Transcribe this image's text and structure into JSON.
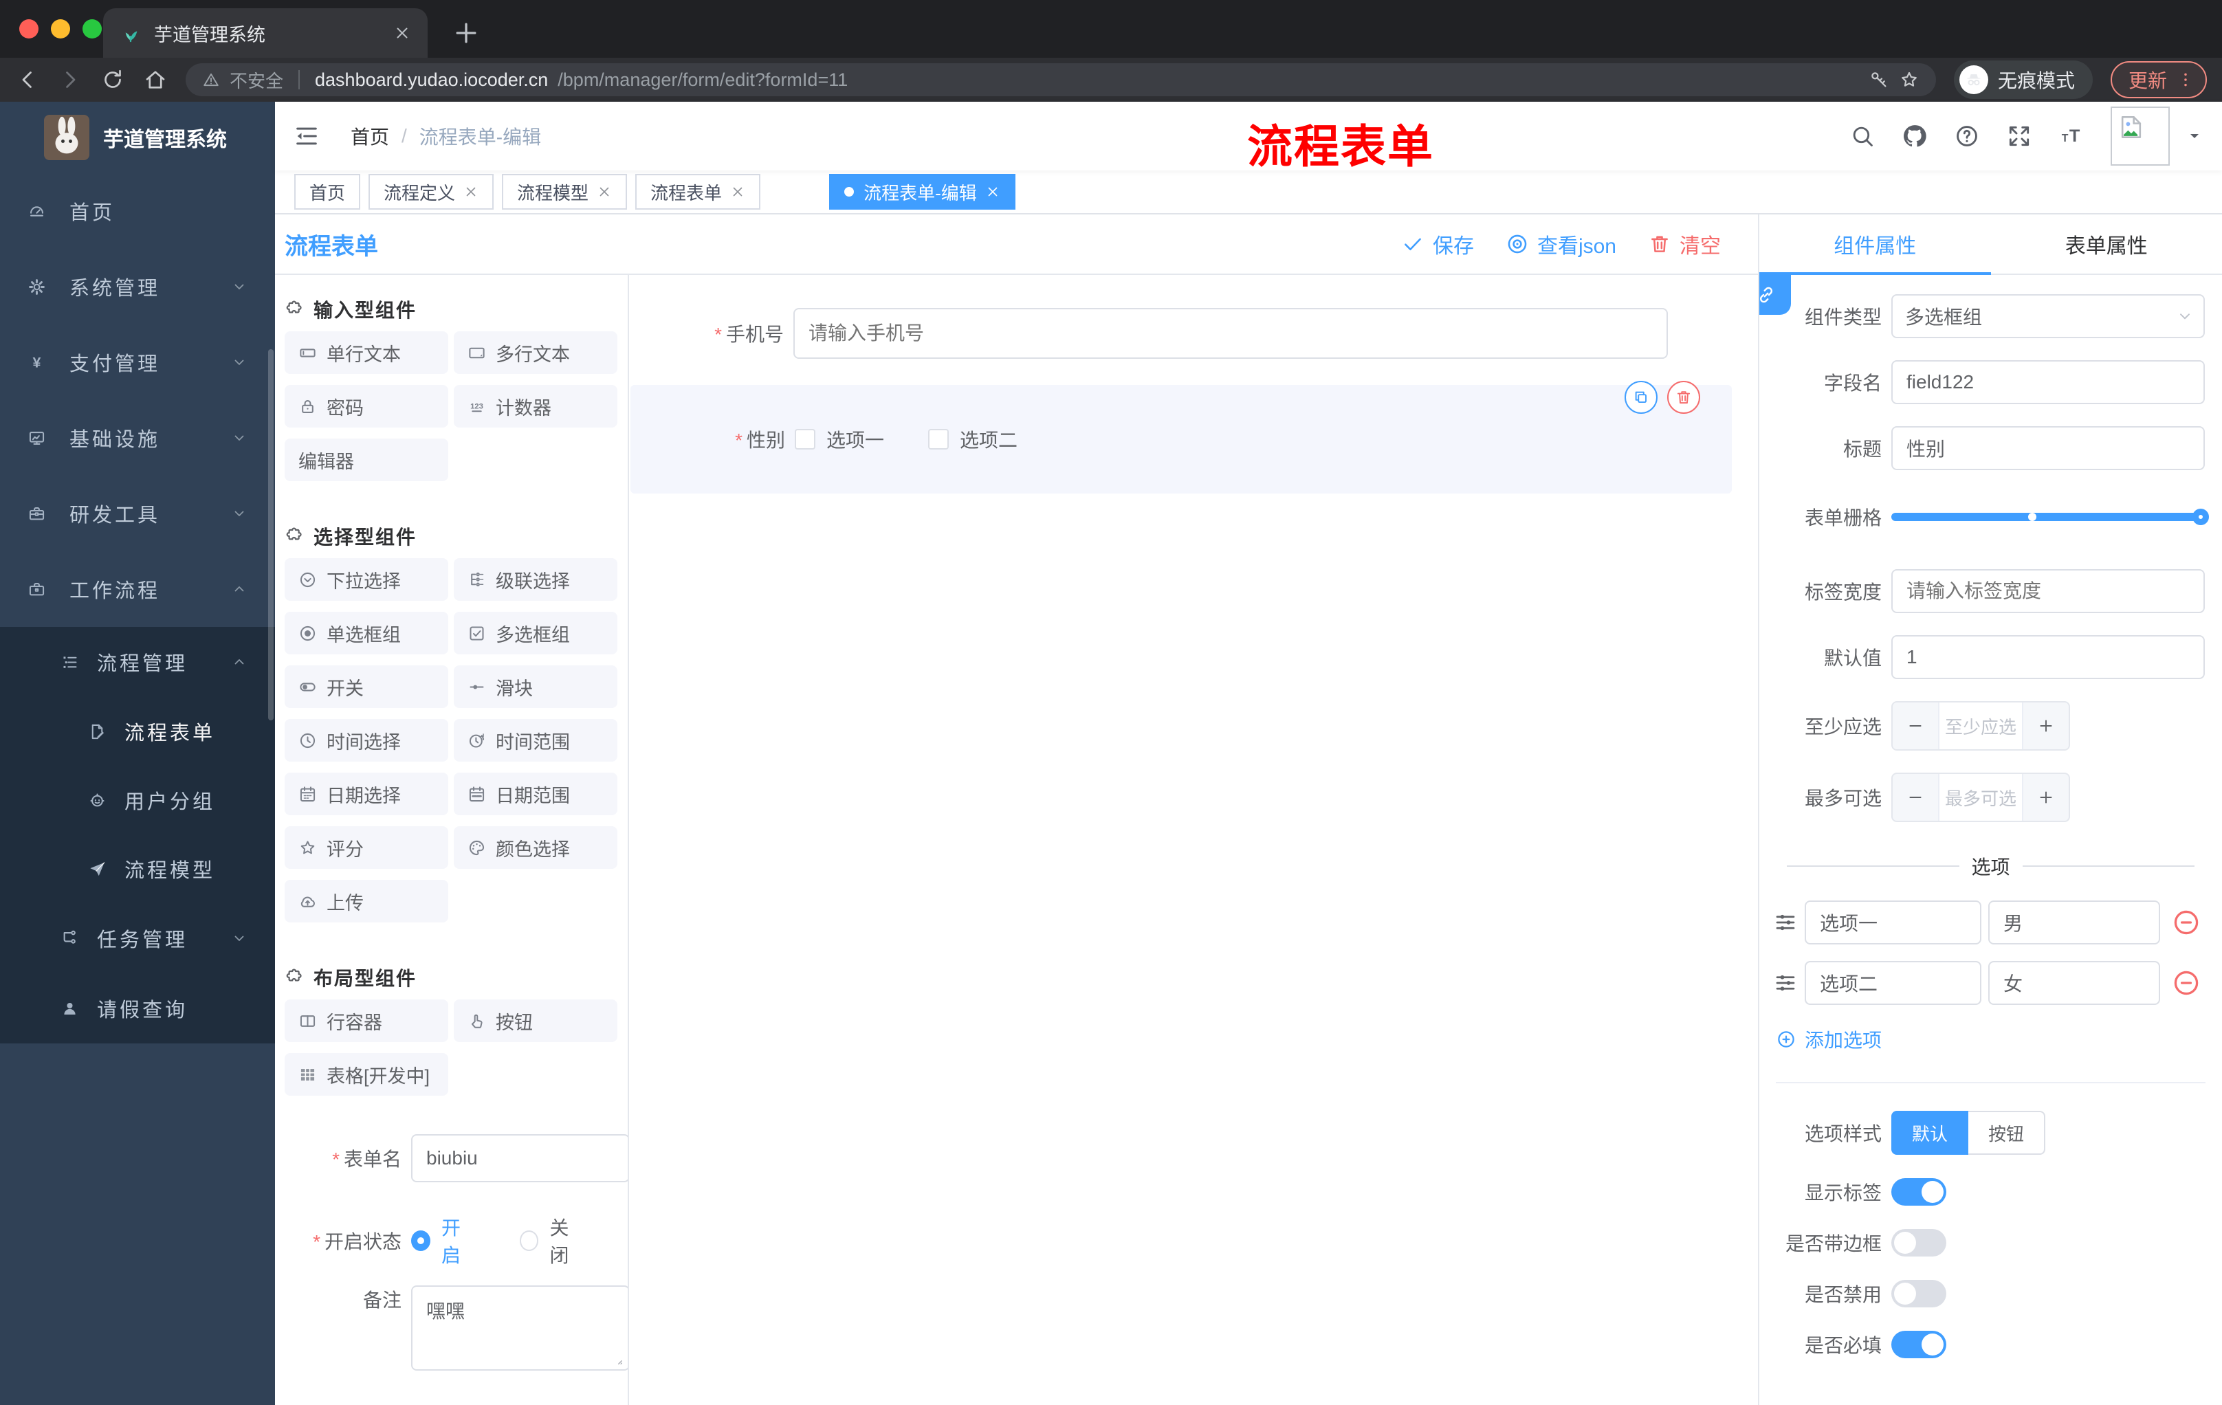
{
  "theme": {
    "accent": "#409EFF",
    "danger": "#F56C6C",
    "annotation": "#FE0000",
    "sidebar_bg": "#304156",
    "submenu_bg": "#1F2D3D",
    "sidebar_text": "#BFCBD9"
  },
  "browser": {
    "tab_title": "芋道管理系统",
    "security_label": "不安全",
    "url_host": "dashboard.yudao.iocoder.cn",
    "url_path": "/bpm/manager/form/edit?formId=11",
    "incognito_label": "无痕模式",
    "update_label": "更新"
  },
  "sidebar": {
    "logo_title": "芋道管理系统",
    "items": [
      {
        "key": "home",
        "label": "首页",
        "icon": "dashboard",
        "level": 1,
        "chevron": null,
        "active": false
      },
      {
        "key": "system-mgmt",
        "label": "系统管理",
        "icon": "gear",
        "level": 1,
        "chevron": "down",
        "active": false
      },
      {
        "key": "payment-mgmt",
        "label": "支付管理",
        "icon": "yen",
        "level": 1,
        "chevron": "down",
        "active": false
      },
      {
        "key": "infrastructure",
        "label": "基础设施",
        "icon": "monitor",
        "level": 1,
        "chevron": "down",
        "active": false
      },
      {
        "key": "dev-tools",
        "label": "研发工具",
        "icon": "toolbox",
        "level": 1,
        "chevron": "down",
        "active": false
      },
      {
        "key": "workflow",
        "label": "工作流程",
        "icon": "briefcase",
        "level": 1,
        "chevron": "up",
        "active": false
      },
      {
        "key": "process-mgmt",
        "label": "流程管理",
        "icon": "tree-list",
        "level": 2,
        "chevron": "up",
        "active": false
      },
      {
        "key": "process-form",
        "label": "流程表单",
        "icon": "doc-edit",
        "level": 3,
        "chevron": null,
        "active": true
      },
      {
        "key": "user-group",
        "label": "用户分组",
        "icon": "robot",
        "level": 3,
        "chevron": null,
        "active": false
      },
      {
        "key": "process-model",
        "label": "流程模型",
        "icon": "paper-plane",
        "level": 3,
        "chevron": null,
        "active": false
      },
      {
        "key": "task-mgmt",
        "label": "任务管理",
        "icon": "flow-tree",
        "level": 2,
        "chevron": "down",
        "active": false
      },
      {
        "key": "leave-query",
        "label": "请假查询",
        "icon": "user",
        "level": 2,
        "chevron": null,
        "active": false
      }
    ]
  },
  "header": {
    "breadcrumb": [
      "首页",
      "流程表单-编辑"
    ],
    "breadcrumb_sep": "/",
    "annotation": "流程表单"
  },
  "tags": {
    "items": [
      {
        "key": "home",
        "label": "首页",
        "closable": false,
        "active": false,
        "gap": false
      },
      {
        "key": "process-definition",
        "label": "流程定义",
        "closable": true,
        "active": false,
        "gap": false
      },
      {
        "key": "process-model",
        "label": "流程模型",
        "closable": true,
        "active": false,
        "gap": false
      },
      {
        "key": "process-form",
        "label": "流程表单",
        "closable": true,
        "active": false,
        "gap": false
      },
      {
        "key": "process-form-edit",
        "label": "流程表单-编辑",
        "closable": true,
        "active": true,
        "gap": true
      }
    ]
  },
  "designer": {
    "title": "流程表单",
    "save_label": "保存",
    "view_json_label": "查看json",
    "clear_label": "清空"
  },
  "palette": {
    "sections": [
      {
        "key": "input",
        "title": "输入型组件",
        "items": [
          {
            "key": "single-line-text",
            "label": "单行文本",
            "icon": "input"
          },
          {
            "key": "multi-line-text",
            "label": "多行文本",
            "icon": "textarea"
          },
          {
            "key": "password",
            "label": "密码",
            "icon": "lock"
          },
          {
            "key": "counter",
            "label": "计数器",
            "icon": "number"
          },
          {
            "key": "editor",
            "label": "编辑器",
            "icon": null
          }
        ]
      },
      {
        "key": "select",
        "title": "选择型组件",
        "items": [
          {
            "key": "select",
            "label": "下拉选择",
            "icon": "select"
          },
          {
            "key": "cascader",
            "label": "级联选择",
            "icon": "cascader"
          },
          {
            "key": "radio-group",
            "label": "单选框组",
            "icon": "radio"
          },
          {
            "key": "checkbox-group",
            "label": "多选框组",
            "icon": "checkbox"
          },
          {
            "key": "switch",
            "label": "开关",
            "icon": "switch"
          },
          {
            "key": "slider",
            "label": "滑块",
            "icon": "slider"
          },
          {
            "key": "time-picker",
            "label": "时间选择",
            "icon": "time"
          },
          {
            "key": "time-range",
            "label": "时间范围",
            "icon": "time-range"
          },
          {
            "key": "date-picker",
            "label": "日期选择",
            "icon": "date"
          },
          {
            "key": "date-range",
            "label": "日期范围",
            "icon": "date-range"
          },
          {
            "key": "rate",
            "label": "评分",
            "icon": "star"
          },
          {
            "key": "color-picker",
            "label": "颜色选择",
            "icon": "color"
          },
          {
            "key": "upload",
            "label": "上传",
            "icon": "upload"
          }
        ]
      },
      {
        "key": "layout",
        "title": "布局型组件",
        "items": [
          {
            "key": "row-container",
            "label": "行容器",
            "icon": "row"
          },
          {
            "key": "button",
            "label": "按钮",
            "icon": "button-hand"
          },
          {
            "key": "table",
            "label": "表格[开发中]",
            "icon": "table"
          }
        ]
      }
    ]
  },
  "form_meta": {
    "name_label": "表单名",
    "name_value": "biubiu",
    "status_label": "开启状态",
    "status_on": "开启",
    "status_off": "关闭",
    "remark_label": "备注",
    "remark_value": "嘿嘿"
  },
  "canvas": {
    "phone": {
      "label": "手机号",
      "placeholder": "请输入手机号"
    },
    "gender": {
      "label": "性别",
      "options": [
        "选项一",
        "选项二"
      ]
    }
  },
  "props": {
    "tabs": [
      "组件属性",
      "表单属性"
    ],
    "rows": {
      "component_type": {
        "label": "组件类型",
        "value": "多选框组"
      },
      "field_name": {
        "label": "字段名",
        "value": "field122"
      },
      "title": {
        "label": "标题",
        "value": "性别"
      },
      "form_grid": {
        "label": "表单栅格"
      },
      "label_width": {
        "label": "标签宽度",
        "placeholder": "请输入标签宽度"
      },
      "default_value": {
        "label": "默认值",
        "value": "1"
      },
      "min_select": {
        "label": "至少应选",
        "placeholder": "至少应选"
      },
      "max_select": {
        "label": "最多可选",
        "placeholder": "最多可选"
      }
    },
    "options_divider": "选项",
    "option_rows": [
      {
        "label": "选项一",
        "value": "男"
      },
      {
        "label": "选项二",
        "value": "女"
      }
    ],
    "add_option": "添加选项",
    "option_style": {
      "label": "选项样式",
      "options": [
        "默认",
        "按钮"
      ],
      "selected": "默认"
    },
    "toggles": [
      {
        "key": "show-label",
        "label": "显示标签",
        "on": true
      },
      {
        "key": "with-border",
        "label": "是否带边框",
        "on": false
      },
      {
        "key": "disabled",
        "label": "是否禁用",
        "on": false
      },
      {
        "key": "required",
        "label": "是否必填",
        "on": true
      }
    ]
  }
}
